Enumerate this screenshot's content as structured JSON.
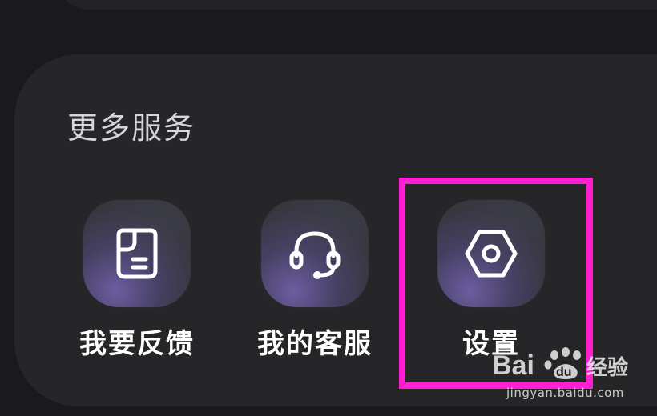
{
  "section": {
    "title": "更多服务"
  },
  "services": [
    {
      "label": "我要反馈",
      "icon": "feedback-note-icon"
    },
    {
      "label": "我的客服",
      "icon": "headset-icon"
    },
    {
      "label": "设置",
      "icon": "settings-hexagon-icon"
    }
  ],
  "annotation": {
    "highlight_color": "#ff1fd2",
    "highlighted_item": "设置"
  },
  "watermark": {
    "logo_text": "Bai du 经验",
    "url": "jingyan.baidu.com"
  },
  "colors": {
    "background": "#1a1a1c",
    "card": "#262628",
    "tile_glow": "#7664b2",
    "text": "#ffffff"
  }
}
